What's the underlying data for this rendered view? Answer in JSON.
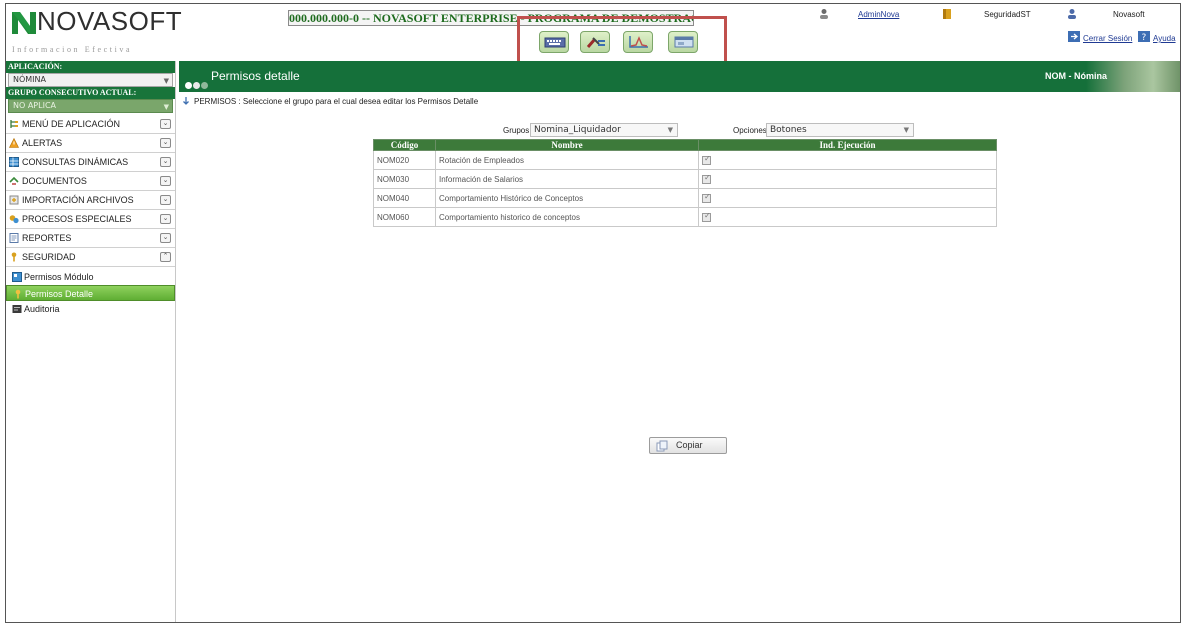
{
  "header": {
    "logo_text": "NOVASOFT",
    "logo_tagline": "Informacion Efectiva",
    "company_prefix": "000.000.000-0 -- NOVASOFT ENTERPRISE - ",
    "company_struck": "PROGRAMA DE DEMOSTRACION",
    "user": "AdminNova",
    "group": "SeguridadST",
    "company_name": "Novasoft",
    "logout": "Cerrar Sesión",
    "help": "Ayuda"
  },
  "quick_actions": [
    {
      "icon": "keyboard-icon"
    },
    {
      "icon": "tools-icon"
    },
    {
      "icon": "chart-icon"
    },
    {
      "icon": "window-icon"
    }
  ],
  "sidebar": {
    "app_label": "APLICACIÓN:",
    "app_value": "NÓMINA",
    "group_label": "GRUPO CONSECUTIVO ACTUAL:",
    "group_value": "NO APLICA",
    "menu": [
      {
        "label": "MENÚ DE APLICACIÓN",
        "icon": "tree-icon"
      },
      {
        "label": "ALERTAS",
        "icon": "warning-icon"
      },
      {
        "label": "CONSULTAS DINÁMICAS",
        "icon": "table-icon"
      },
      {
        "label": "DOCUMENTOS",
        "icon": "documents-icon"
      },
      {
        "label": "IMPORTACIÓN ARCHIVOS",
        "icon": "import-icon"
      },
      {
        "label": "PROCESOS ESPECIALES",
        "icon": "gears-icon"
      },
      {
        "label": "REPORTES",
        "icon": "report-icon"
      },
      {
        "label": "SEGURIDAD",
        "icon": "key-icon"
      }
    ],
    "submenu": [
      {
        "label": "Permisos Módulo",
        "active": false
      },
      {
        "label": "Permisos Detalle",
        "active": true
      },
      {
        "label": "Auditoria",
        "active": false
      }
    ]
  },
  "titlebar": {
    "title": "Permisos detalle",
    "module": "NOM - Nómina"
  },
  "hint": "PERMISOS : Seleccione el grupo para el cual desea editar los Permisos Detalle",
  "filters": {
    "grupos_label": "Grupos",
    "grupos_value": "Nomina_Liquidador",
    "opciones_label": "Opciones",
    "opciones_value": "Botones"
  },
  "table": {
    "columns": [
      "Código",
      "Nombre",
      "Ind. Ejecución"
    ],
    "rows": [
      {
        "code": "NOM020",
        "name": "Rotación de Empleados",
        "checked": true
      },
      {
        "code": "NOM030",
        "name": "Información de Salarios",
        "checked": true
      },
      {
        "code": "NOM040",
        "name": "Comportamiento Histórico de Conceptos",
        "checked": true
      },
      {
        "code": "NOM060",
        "name": "Comportamiento historico de conceptos",
        "checked": true
      }
    ]
  },
  "copy_button": "Copiar",
  "colors": {
    "brand_green": "#15703a",
    "highlight_box": "#c0504d",
    "active_item": "#6cbb3c"
  }
}
